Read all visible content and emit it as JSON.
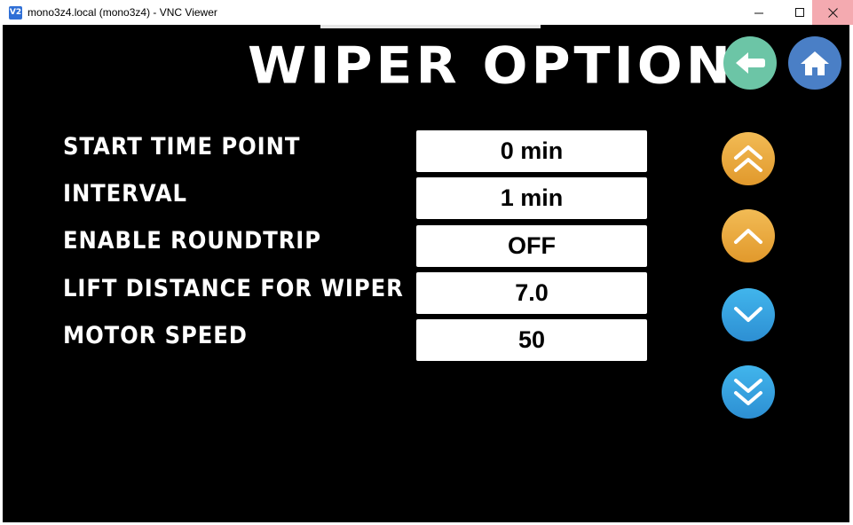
{
  "window": {
    "icon_text": "V2",
    "title": "mono3z4.local (mono3z4) - VNC Viewer"
  },
  "page": {
    "title": "WIPER OPTION"
  },
  "icons": {
    "back": "arrow-left-icon",
    "home": "home-icon",
    "page_up": "double-chevron-up-icon",
    "line_up": "chevron-up-icon",
    "line_down": "chevron-down-icon",
    "page_down": "double-chevron-down-icon"
  },
  "colors": {
    "back": "#6cc5a6",
    "home": "#4a7fc6",
    "up": "#eba942",
    "down": "#38a6e4"
  },
  "settings": [
    {
      "label": "START TIME POINT",
      "value": "0 min"
    },
    {
      "label": "INTERVAL",
      "value": "1 min"
    },
    {
      "label": "ENABLE ROUNDTRIP",
      "value": "OFF"
    },
    {
      "label": "LIFT DISTANCE FOR WIPER",
      "value": "7.0"
    },
    {
      "label": "MOTOR SPEED",
      "value": "50"
    }
  ]
}
